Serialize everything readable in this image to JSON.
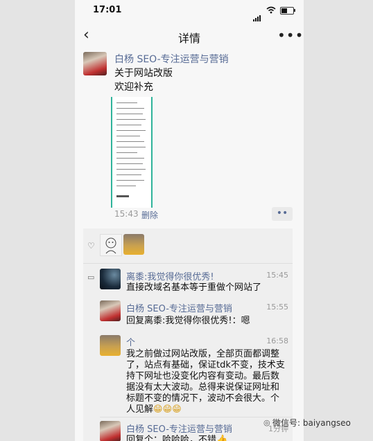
{
  "status_bar": {
    "time": "17:01"
  },
  "nav": {
    "title": "详情",
    "back": "‹",
    "more": "•••"
  },
  "post": {
    "author": "白杨 SEO-专注运营与营销",
    "lines": [
      "关于网站改版",
      "欢迎补充"
    ],
    "time": "15:43",
    "delete_label": "删除",
    "action_dots": "••"
  },
  "comments": [
    {
      "name": "离黍:我觉得你很优秀!",
      "time": "15:45",
      "text": "直接改域名基本等于重做个网站了"
    },
    {
      "name": "白杨 SEO-专注运营与营销",
      "time": "15:55",
      "text": "回复离黍:我觉得你很优秀!：嗯"
    },
    {
      "name": "个",
      "time": "16:58",
      "lines": [
        "我之前做过网站改版，全部页面都调整",
        "了，站点有基础，保证tdk不变，技术支",
        "持下网址也没变化内容有变动。最后数",
        "据没有太大波动。总得来说保证网址和",
        "标题不变的情况下，波动不会很大。个"
      ],
      "last_line": "人见解",
      "emojis": "😁😁😁"
    },
    {
      "name": "白杨 SEO-专注运营与营销",
      "time": "1分钟",
      "text": "回复个：哈哈哈，不错👍"
    }
  ],
  "watermark": "微信号: baiyangseo",
  "icons": [
    "back-chevron-icon",
    "more-icon",
    "heart-icon",
    "comment-bubble-icon",
    "wechat-icon"
  ]
}
